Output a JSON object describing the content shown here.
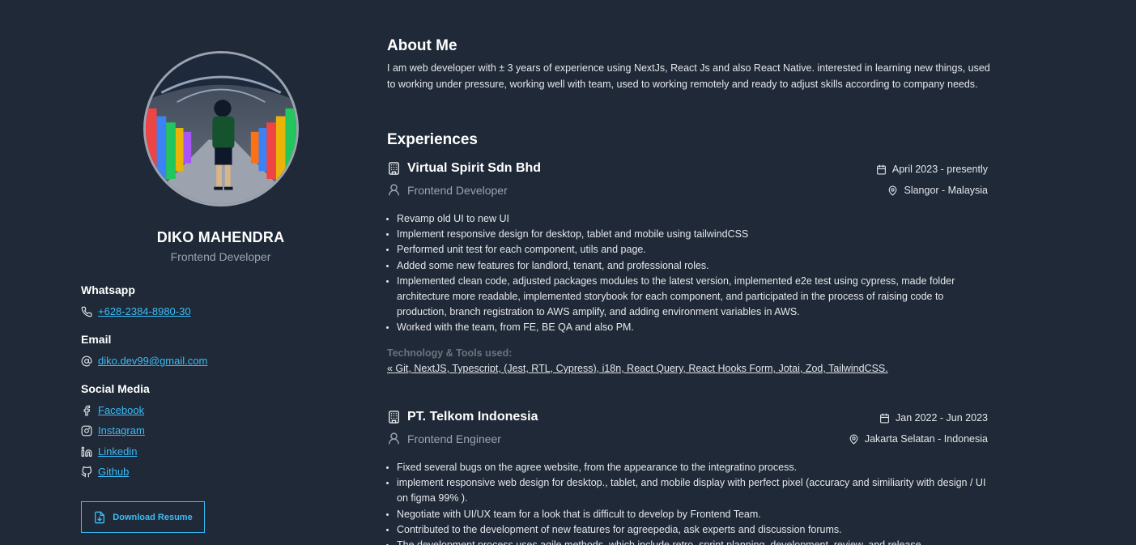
{
  "profile": {
    "name": "DIKO MAHENDRA",
    "role": "Frontend Developer"
  },
  "contact": {
    "whatsapp_label": "Whatsapp",
    "whatsapp_value": "+628-2384-8980-30",
    "email_label": "Email",
    "email_value": "diko.dev99@gmail.com",
    "social_label": "Social Media",
    "social": [
      {
        "label": "Facebook",
        "icon": "facebook-icon"
      },
      {
        "label": "Instagram",
        "icon": "instagram-icon"
      },
      {
        "label": "Linkedin",
        "icon": "linkedin-icon"
      },
      {
        "label": "Github",
        "icon": "github-icon"
      }
    ],
    "download_label": "Download Resume"
  },
  "about": {
    "title": "About Me",
    "text": "I am web developer with ± 3 years of experience using NextJs, React Js and also React Native. interested in learning new things, used to working under pressure, working well with team, used to working remotely and ready to adjust skills according to company needs."
  },
  "experiences": {
    "title": "Experiences",
    "items": [
      {
        "company": "Virtual Spirit Sdn Bhd",
        "role": "Frontend Developer",
        "period": "April 2023 - presently",
        "location": "Slangor - Malaysia",
        "bullets": [
          "Revamp old UI to new UI",
          "Implement responsive design for desktop, tablet and mobile using tailwindCSS",
          "Performed unit test for each component, utils and page.",
          "Added some new features for landlord, tenant, and professional roles.",
          "Implemented clean code, adjusted packages modules to the latest version, implemented e2e test using cypress, made folder architecture more readable, implemented storybook for each component, and participated in the process of raising code to production, branch registration to AWS amplify, and adding environment variables in AWS.",
          "Worked with the team, from FE, BE QA and also PM."
        ],
        "tools_label": "Technology & Tools used:",
        "tools": "« Git, NextJS, Typescript, (Jest, RTL, Cypress), i18n, React Query, React Hooks Form, Jotai, Zod, TailwindCSS."
      },
      {
        "company": "PT. Telkom Indonesia",
        "role": "Frontend Engineer",
        "period": "Jan 2022 - Jun 2023",
        "location": "Jakarta Selatan - Indonesia",
        "bullets": [
          "Fixed several bugs on the agree website, from the appearance to the integratino process.",
          "implement responsive web design for desktop., tablet, and mobile display with perfect pixel (accuracy and similiarity with design / UI on figma 99% ).",
          "Negotiate with UI/UX team for a look that is difficult to develop by Frontend Team.",
          "Contributed to the development of new features for agreepedia, ask experts and discussion forums.",
          "The development process uses agile methods, which include retro, sprint planning, development, review, and release."
        ]
      }
    ]
  },
  "colors": {
    "background": "#1f2937",
    "accent": "#38bdf8",
    "muted": "#9ca3af"
  }
}
